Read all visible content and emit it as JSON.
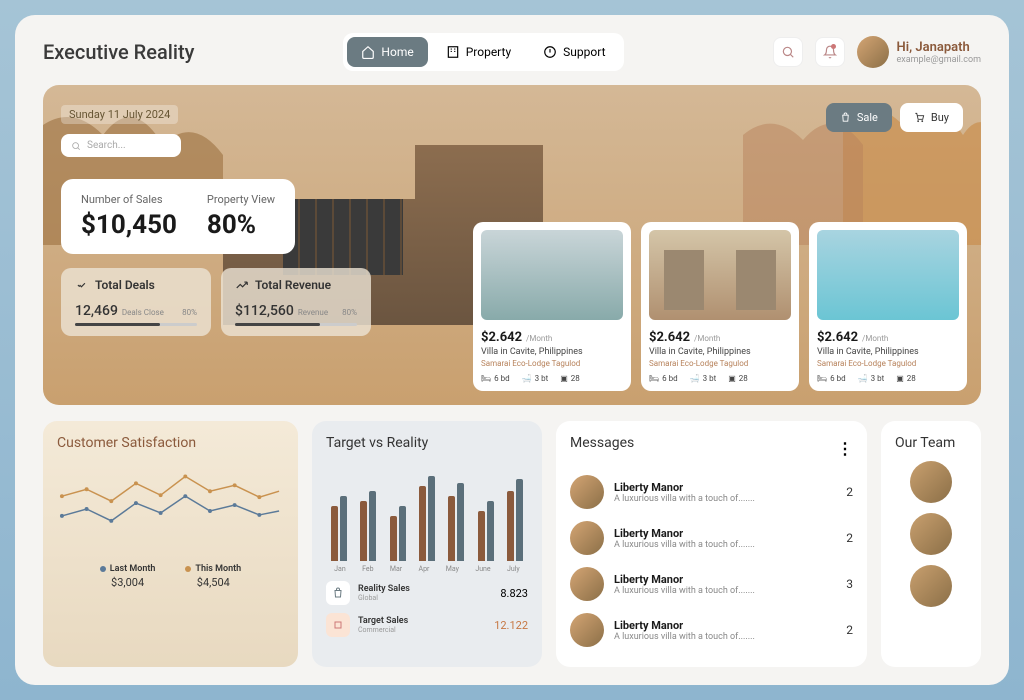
{
  "logo": "Executive Reality",
  "nav": {
    "home": "Home",
    "property": "Property",
    "support": "Support"
  },
  "user": {
    "greeting": "Hi, Janapath",
    "email": "example@gmail.com"
  },
  "hero": {
    "date": "Sunday 11 July 2024",
    "search_placeholder": "Search...",
    "sales_label": "Number of Sales",
    "sales_value": "$10,450",
    "view_label": "Property View",
    "view_value": "80%",
    "deals_title": "Total Deals",
    "deals_num": "12,469",
    "deals_sub": "Deals Close",
    "deals_pct": "80%",
    "revenue_title": "Total Revenue",
    "revenue_num": "$112,560",
    "revenue_sub": "Revenue",
    "revenue_pct": "80%",
    "sale": "Sale",
    "buy": "Buy"
  },
  "props": [
    {
      "price": "$2.642",
      "period": "/Month",
      "name": "Villa in Cavite, Philippines",
      "loc": "Samarai Eco-Lodge Tagulod",
      "bd": "6 bd",
      "bt": "3 bt",
      "sq": "28"
    },
    {
      "price": "$2.642",
      "period": "/Month",
      "name": "Villa in Cavite, Philippines",
      "loc": "Samarai Eco-Lodge Tagulod",
      "bd": "6 bd",
      "bt": "3 bt",
      "sq": "28"
    },
    {
      "price": "$2.642",
      "period": "/Month",
      "name": "Villa in Cavite, Philippines",
      "loc": "Samarai Eco-Lodge Tagulod",
      "bd": "6 bd",
      "bt": "3 bt",
      "sq": "28"
    }
  ],
  "satisfaction": {
    "title": "Customer Satisfaction",
    "last_label": "Last Month",
    "last_val": "$3,004",
    "this_label": "This Month",
    "this_val": "$4,504"
  },
  "target": {
    "title": "Target vs Reality",
    "months": [
      "Jan",
      "Feb",
      "Mar",
      "Apr",
      "May",
      "June",
      "July"
    ],
    "reality_name": "Reality Sales",
    "reality_sub": "Global",
    "reality_val": "8.823",
    "target_name": "Target Sales",
    "target_sub": "Commercial",
    "target_val": "12.122"
  },
  "messages": {
    "title": "Messages",
    "items": [
      {
        "name": "Liberty Manor",
        "text": "A luxurious villa with a touch of.......",
        "count": "2"
      },
      {
        "name": "Liberty Manor",
        "text": "A luxurious villa with a touch of.......",
        "count": "2"
      },
      {
        "name": "Liberty Manor",
        "text": "A luxurious villa with a touch of.......",
        "count": "3"
      },
      {
        "name": "Liberty Manor",
        "text": "A luxurious villa with a touch of.......",
        "count": "2"
      }
    ]
  },
  "team": {
    "title": "Our Team"
  },
  "chart_data": [
    {
      "type": "line",
      "title": "Customer Satisfaction",
      "xlabel": "",
      "ylabel": "",
      "series": [
        {
          "name": "Last Month",
          "values": [
            35,
            42,
            30,
            48,
            38,
            55,
            40,
            45,
            36
          ],
          "color": "#5b7a99"
        },
        {
          "name": "This Month",
          "values": [
            55,
            62,
            50,
            68,
            56,
            75,
            60,
            66,
            54
          ],
          "color": "#c9924f"
        }
      ]
    },
    {
      "type": "bar",
      "title": "Target vs Reality",
      "categories": [
        "Jan",
        "Feb",
        "Mar",
        "Apr",
        "May",
        "June",
        "July"
      ],
      "series": [
        {
          "name": "Reality Sales",
          "color": "#8b5a3c",
          "values": [
            55,
            60,
            45,
            75,
            65,
            50,
            70
          ]
        },
        {
          "name": "Target Sales",
          "color": "#5b6f7a",
          "values": [
            65,
            70,
            55,
            85,
            78,
            60,
            82
          ]
        }
      ],
      "ylim": [
        0,
        100
      ]
    }
  ]
}
